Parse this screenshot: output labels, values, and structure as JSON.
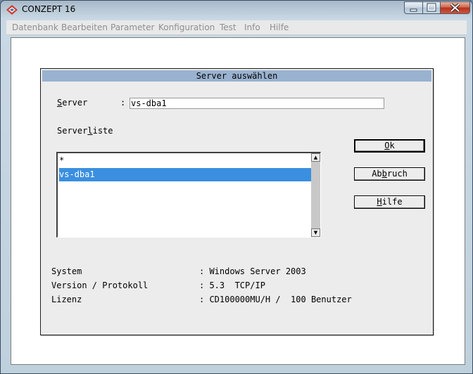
{
  "window": {
    "title": "CONZEPT 16"
  },
  "menu": [
    "Datenbank",
    "Bearbeiten",
    "Parameter",
    "Konfiguration",
    "Test",
    "Info",
    "Hilfe"
  ],
  "dialog": {
    "title": "Server auswählen",
    "server_label_key": "S",
    "server_label_rest": "erver",
    "server_colon": ":",
    "server_value": "vs-dba1",
    "serverliste_pre": "Server",
    "serverliste_key": "l",
    "serverliste_post": "iste",
    "list_items": [
      "*",
      "vs-dba1"
    ],
    "selected_index": 1,
    "buttons": {
      "ok_key": "O",
      "ok_rest": "k",
      "abbruch_pre": "Ab",
      "abbruch_key": "b",
      "abbruch_post": "ruch",
      "hilfe_key": "H",
      "hilfe_rest": "ilfe"
    },
    "info": [
      {
        "label": "System",
        "value": ": Windows Server 2003"
      },
      {
        "label": "Version / Protokoll",
        "value": ": 5.3  TCP/IP"
      },
      {
        "label": "Lizenz",
        "value": ": CD100000MU/H /  100 Benutzer"
      }
    ]
  },
  "colors": {
    "dialog_title_bg": "#99b2cf",
    "selection": "#3a8fe0"
  }
}
